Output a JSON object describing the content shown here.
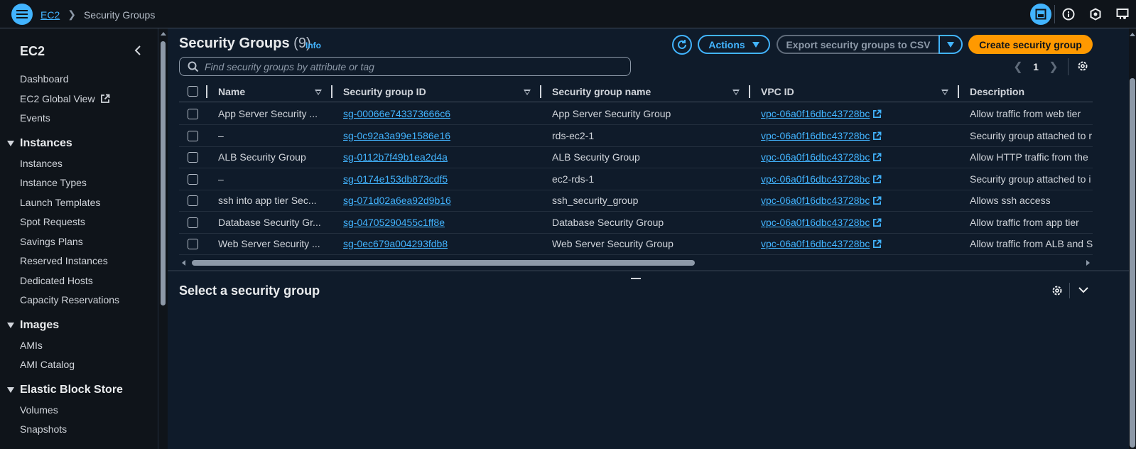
{
  "breadcrumb": {
    "service": "EC2",
    "current": "Security Groups"
  },
  "sidebar": {
    "title": "EC2",
    "top_items": [
      "Dashboard",
      "EC2 Global View",
      "Events"
    ],
    "sections": [
      {
        "label": "Instances",
        "items": [
          "Instances",
          "Instance Types",
          "Launch Templates",
          "Spot Requests",
          "Savings Plans",
          "Reserved Instances",
          "Dedicated Hosts",
          "Capacity Reservations"
        ]
      },
      {
        "label": "Images",
        "items": [
          "AMIs",
          "AMI Catalog"
        ]
      },
      {
        "label": "Elastic Block Store",
        "items": [
          "Volumes",
          "Snapshots"
        ]
      }
    ]
  },
  "header": {
    "title": "Security Groups",
    "count": "(9)",
    "info": "Info",
    "actions_label": "Actions",
    "export_label": "Export security groups to CSV",
    "create_label": "Create security group"
  },
  "search": {
    "placeholder": "Find security groups by attribute or tag",
    "value": ""
  },
  "pagination": {
    "current_page": "1"
  },
  "table": {
    "columns": [
      "Name",
      "Security group ID",
      "Security group name",
      "VPC ID",
      "Description"
    ],
    "rows": [
      {
        "name": "App Server Security ...",
        "id": "sg-00066e743373666c6",
        "group_name": "App Server Security Group",
        "vpc": "vpc-06a0f16dbc43728bc",
        "description": "Allow traffic from web tier"
      },
      {
        "name": "–",
        "id": "sg-0c92a3a99e1586e16",
        "group_name": "rds-ec2-1",
        "vpc": "vpc-06a0f16dbc43728bc",
        "description": "Security group attached to r"
      },
      {
        "name": "ALB Security Group",
        "id": "sg-0112b7f49b1ea2d4a",
        "group_name": "ALB Security Group",
        "vpc": "vpc-06a0f16dbc43728bc",
        "description": "Allow HTTP traffic from the"
      },
      {
        "name": "–",
        "id": "sg-0174e153db873cdf5",
        "group_name": "ec2-rds-1",
        "vpc": "vpc-06a0f16dbc43728bc",
        "description": "Security group attached to i"
      },
      {
        "name": "ssh into app tier Sec...",
        "id": "sg-071d02a6ea92d9b16",
        "group_name": "ssh_security_group",
        "vpc": "vpc-06a0f16dbc43728bc",
        "description": "Allows ssh access"
      },
      {
        "name": "Database Security Gr...",
        "id": "sg-04705290455c1ff8e",
        "group_name": "Database Security Group",
        "vpc": "vpc-06a0f16dbc43728bc",
        "description": "Allow traffic from app tier"
      },
      {
        "name": "Web Server Security ...",
        "id": "sg-0ec679a004293fdb8",
        "group_name": "Web Server Security Group",
        "vpc": "vpc-06a0f16dbc43728bc",
        "description": "Allow traffic from ALB and S"
      }
    ]
  },
  "detail": {
    "title": "Select a security group"
  },
  "colors": {
    "accent": "#42b4ff",
    "primary_button": "#ff9900",
    "background": "#0f1b2a",
    "chrome": "#0f141a"
  }
}
